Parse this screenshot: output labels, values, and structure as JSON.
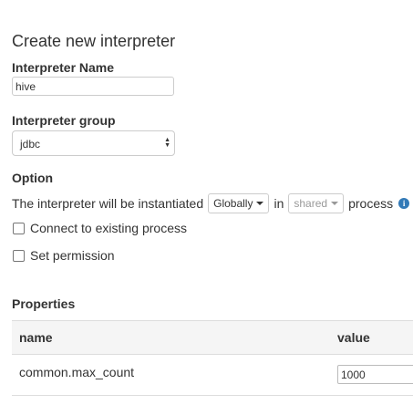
{
  "dialog": {
    "title": "Create new interpreter",
    "name_label": "Interpreter Name",
    "name_value": "hive",
    "group_label": "Interpreter group",
    "group_value": "jdbc",
    "option_label": "Option",
    "instantiate_prefix": "The interpreter will be instantiated",
    "scope_value": "Globally",
    "in_text": "in",
    "mode_value": "shared",
    "process_text": "process",
    "info_icon": "info-icon",
    "connect_label": "Connect to existing process",
    "permission_label": "Set permission"
  },
  "properties": {
    "label": "Properties",
    "columns": [
      "name",
      "value"
    ],
    "rows": [
      {
        "name": "common.max_count",
        "value": "1000"
      }
    ]
  },
  "colors": {
    "accent": "#337ab7",
    "header_bg": "#f5f5f5",
    "border": "#dddddd"
  }
}
